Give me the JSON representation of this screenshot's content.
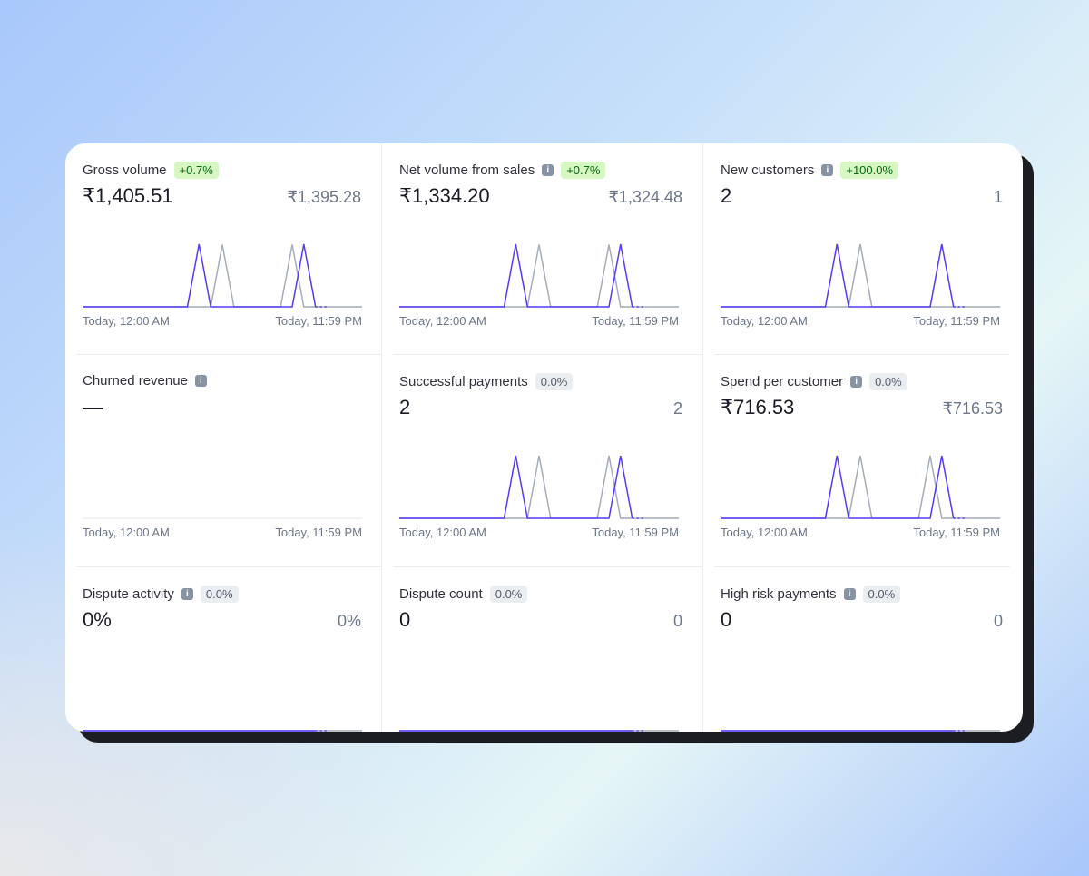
{
  "colors": {
    "current": "#533afd",
    "previous": "#a3acb9",
    "positive_badge_bg": "#d7f7c2",
    "positive_badge_text": "#05690d"
  },
  "axis": {
    "start": "Today, 12:00 AM",
    "end": "Today, 11:59 PM"
  },
  "metrics": [
    {
      "title": "Gross volume",
      "info": false,
      "badge": "+0.7%",
      "badge_type": "positive",
      "value": "₹1,405.51",
      "compare": "₹1,395.28",
      "show_axis": true,
      "chart_data": {
        "type": "line",
        "x_unit": "hour",
        "current": {
          "peaks": {
            "10": 702.76,
            "19": 702.75
          },
          "last_hour": 21
        },
        "previous": {
          "peaks": {
            "12": 697.64,
            "18": 697.64
          }
        }
      }
    },
    {
      "title": "Net volume from sales",
      "info": true,
      "badge": "+0.7%",
      "badge_type": "positive",
      "value": "₹1,334.20",
      "compare": "₹1,324.48",
      "show_axis": true,
      "chart_data": {
        "type": "line",
        "x_unit": "hour",
        "current": {
          "peaks": {
            "10": 667.1,
            "19": 667.1
          },
          "last_hour": 21
        },
        "previous": {
          "peaks": {
            "12": 662.24,
            "18": 662.24
          }
        }
      }
    },
    {
      "title": "New customers",
      "info": true,
      "badge": "+100.0%",
      "badge_type": "positive",
      "value": "2",
      "compare": "1",
      "show_axis": true,
      "chart_data": {
        "type": "line",
        "x_unit": "hour",
        "current": {
          "peaks": {
            "10": 1,
            "19": 1
          },
          "last_hour": 21
        },
        "previous": {
          "peaks": {
            "12": 1
          }
        }
      }
    },
    {
      "title": "Churned revenue",
      "info": true,
      "badge": "",
      "badge_type": "",
      "value": "—",
      "compare": "",
      "show_axis": true,
      "chart_data": {
        "type": "line",
        "empty": true
      }
    },
    {
      "title": "Successful payments",
      "info": false,
      "badge": "0.0%",
      "badge_type": "neutral",
      "value": "2",
      "compare": "2",
      "show_axis": true,
      "chart_data": {
        "type": "line",
        "x_unit": "hour",
        "current": {
          "peaks": {
            "10": 1,
            "19": 1
          },
          "last_hour": 21
        },
        "previous": {
          "peaks": {
            "12": 1,
            "18": 1
          }
        }
      }
    },
    {
      "title": "Spend per customer",
      "info": true,
      "badge": "0.0%",
      "badge_type": "neutral",
      "value": "₹716.53",
      "compare": "₹716.53",
      "show_axis": true,
      "chart_data": {
        "type": "line",
        "x_unit": "hour",
        "current": {
          "peaks": {
            "10": 716.53,
            "19": 716.53
          },
          "last_hour": 21
        },
        "previous": {
          "peaks": {
            "12": 716.53,
            "18": 716.53
          }
        }
      }
    },
    {
      "title": "Dispute activity",
      "info": true,
      "badge": "0.0%",
      "badge_type": "neutral",
      "value": "0%",
      "compare": "0%",
      "show_axis": false,
      "chart_data": {
        "type": "line",
        "x_unit": "hour",
        "current": {
          "peaks": {},
          "last_hour": 21
        },
        "previous": {
          "peaks": {}
        }
      }
    },
    {
      "title": "Dispute count",
      "info": false,
      "badge": "0.0%",
      "badge_type": "neutral",
      "value": "0",
      "compare": "0",
      "show_axis": false,
      "chart_data": {
        "type": "line",
        "x_unit": "hour",
        "current": {
          "peaks": {},
          "last_hour": 21
        },
        "previous": {
          "peaks": {}
        }
      }
    },
    {
      "title": "High risk payments",
      "info": true,
      "badge": "0.0%",
      "badge_type": "neutral",
      "value": "0",
      "compare": "0",
      "show_axis": false,
      "chart_data": {
        "type": "line",
        "x_unit": "hour",
        "current": {
          "peaks": {},
          "last_hour": 21
        },
        "previous": {
          "peaks": {}
        }
      }
    }
  ]
}
